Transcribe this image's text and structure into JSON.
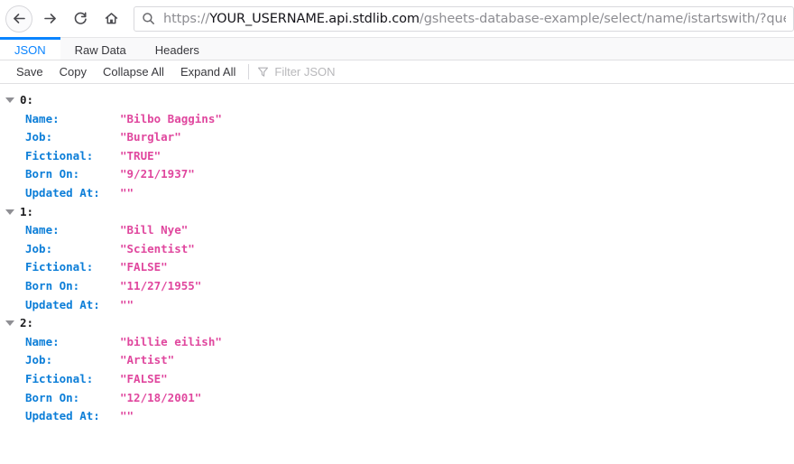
{
  "browser": {
    "nav": {
      "back_label": "Back",
      "forward_label": "Forward",
      "reload_label": "Reload",
      "home_label": "Home"
    },
    "url": {
      "scheme": "https://",
      "host": "YOUR_USERNAME.api.stdlib.com",
      "path": "/gsheets-database-example/select/name/istartswith/?query=bil",
      "full": "https://YOUR_USERNAME.api.stdlib.com/gsheets-database-example/select/name/istartswith/?query=bil"
    }
  },
  "viewer": {
    "tabs": [
      {
        "label": "JSON",
        "active": true
      },
      {
        "label": "Raw Data",
        "active": false
      },
      {
        "label": "Headers",
        "active": false
      }
    ],
    "toolbar": {
      "save": "Save",
      "copy": "Copy",
      "collapse_all": "Collapse All",
      "expand_all": "Expand All",
      "filter_placeholder": "Filter JSON",
      "filter_icon": "funnel-icon"
    },
    "accent_color": "#0a84ff",
    "key_color": "#0c7ed8",
    "value_color": "#e0479e"
  },
  "json": {
    "keys": [
      "Name:",
      "Job:",
      "Fictional:",
      "Born On:",
      "Updated At:"
    ],
    "entries": [
      {
        "index": "0:",
        "values": [
          "\"Bilbo Baggins\"",
          "\"Burglar\"",
          "\"TRUE\"",
          "\"9/21/1937\"",
          "\"\""
        ]
      },
      {
        "index": "1:",
        "values": [
          "\"Bill Nye\"",
          "\"Scientist\"",
          "\"FALSE\"",
          "\"11/27/1955\"",
          "\"\""
        ]
      },
      {
        "index": "2:",
        "values": [
          "\"billie eilish\"",
          "\"Artist\"",
          "\"FALSE\"",
          "\"12/18/2001\"",
          "\"\""
        ]
      }
    ]
  }
}
